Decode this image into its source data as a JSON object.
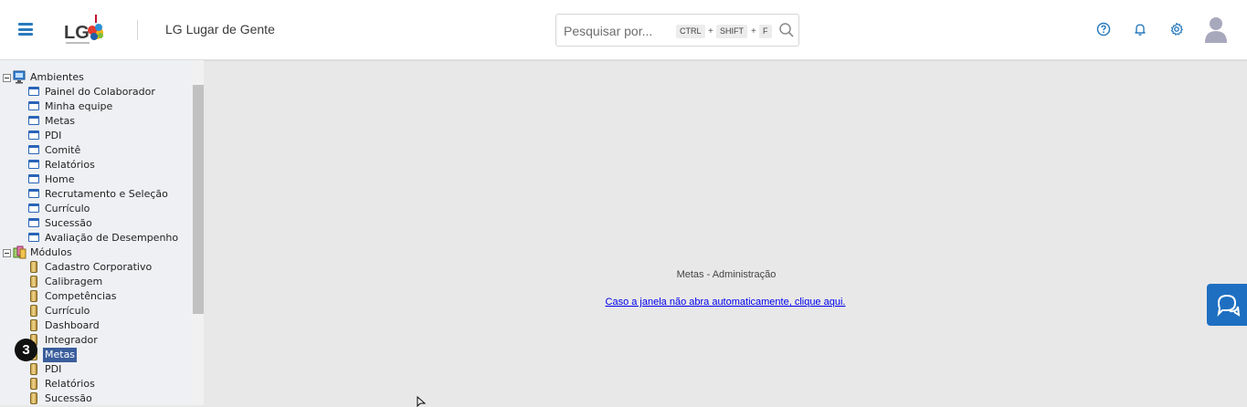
{
  "header": {
    "logo_text": "LG",
    "app_title": "LG Lugar de Gente",
    "search": {
      "placeholder": "Pesquisar por...",
      "shortcut_keys": [
        "CTRL",
        "SHIFT",
        "F"
      ],
      "shortcut_separator": "+"
    },
    "icons": [
      "menu-icon",
      "help-icon",
      "bell-icon",
      "gear-icon",
      "avatar"
    ],
    "accent_color": "#2b7bbd"
  },
  "sidebar": {
    "groups": [
      {
        "label": "Ambientes",
        "icon": "monitor-icon",
        "items": [
          "Painel do Colaborador",
          "Minha equipe",
          "Metas",
          "PDI",
          "Comitê",
          "Relatórios",
          "Home",
          "Recrutamento e Seleção",
          "Currículo",
          "Sucessão",
          "Avaliação de Desempenho"
        ]
      },
      {
        "label": "Módulos",
        "icon": "modules-icon",
        "items": [
          "Cadastro Corporativo",
          "Calibragem",
          "Competências",
          "Currículo",
          "Dashboard",
          "Integrador",
          "Metas",
          "PDI",
          "Relatórios",
          "Sucessão"
        ]
      }
    ],
    "selected_item": "Metas",
    "step_badge": "3",
    "selected_color": "#3a5d9c"
  },
  "main": {
    "title": "Metas - Administração",
    "link_text": "Caso a janela não abra automaticamente, clique aqui."
  }
}
